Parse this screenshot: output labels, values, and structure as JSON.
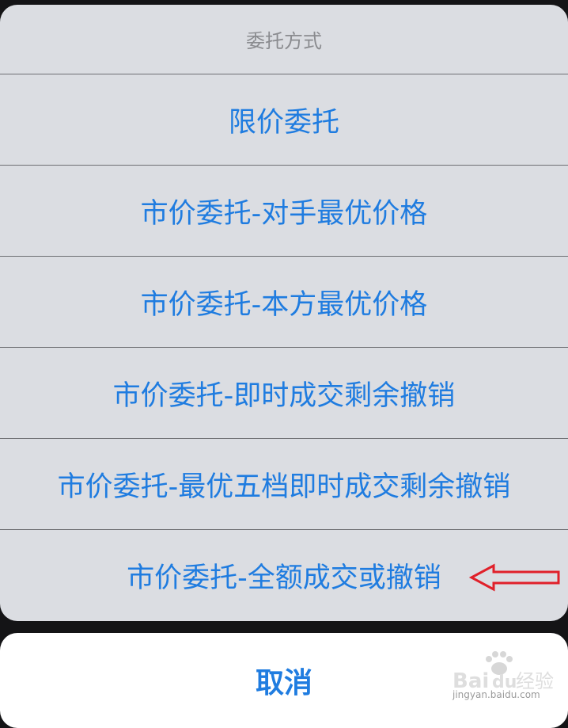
{
  "sheet": {
    "title": "委托方式",
    "options": [
      {
        "label": "限价委托"
      },
      {
        "label": "市价委托-对手最优价格"
      },
      {
        "label": "市价委托-本方最优价格"
      },
      {
        "label": "市价委托-即时成交剩余撤销"
      },
      {
        "label": "市价委托-最优五档即时成交剩余撤销"
      },
      {
        "label": "市价委托-全额成交或撤销"
      }
    ]
  },
  "cancel_label": "取消",
  "watermark": {
    "brand_latin": "Bai",
    "brand_du": "du",
    "brand_cn": "经验",
    "url": "jingyan.baidu.com"
  },
  "colors": {
    "accent": "#1f7ce0",
    "sheet_bg": "#dbdde2",
    "annotation_arrow": "#e0202a"
  }
}
